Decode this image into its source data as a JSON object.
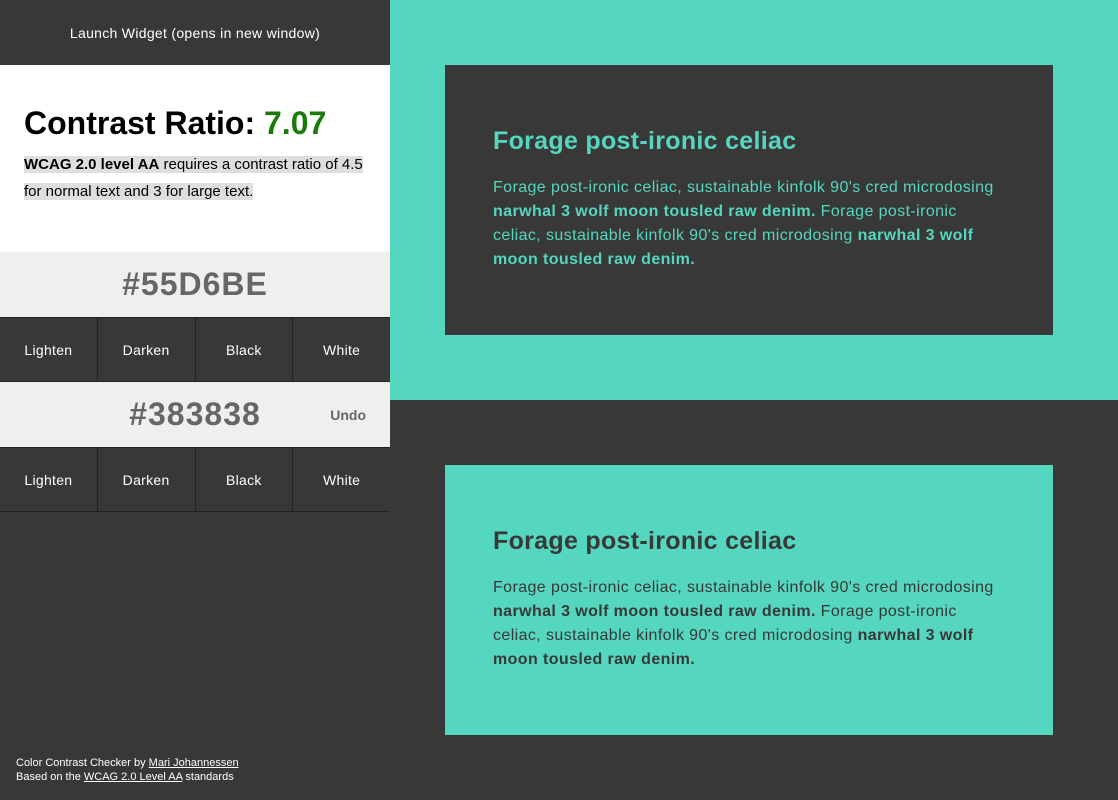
{
  "sidebar": {
    "launch_label": "Launch Widget (opens in new window)",
    "ratio": {
      "label": "Contrast Ratio:",
      "value": "7.07",
      "value_color": "#1a7a0a"
    },
    "wcag": {
      "strong": "WCAG 2.0 level AA",
      "text": " requires a contrast ratio of 4.5 for normal text and 3 for large text."
    },
    "foreground": {
      "hex": "#55D6BE",
      "buttons": [
        "Lighten",
        "Darken",
        "Black",
        "White"
      ]
    },
    "background": {
      "hex": "#383838",
      "undo_label": "Undo",
      "buttons": [
        "Lighten",
        "Darken",
        "Black",
        "White"
      ]
    },
    "credits": {
      "line1_prefix": "Color Contrast Checker by ",
      "author": "Mari Johannessen",
      "line2_prefix": "Based on the ",
      "standard_link": "WCAG 2.0 Level AA",
      "line2_suffix": " standards"
    }
  },
  "preview": {
    "colors": {
      "accent": "#55D6BE",
      "dark": "#383838"
    },
    "heading": "Forage post-ironic celiac",
    "body_part1": "Forage post-ironic celiac, sustainable kinfolk 90's cred microdosing ",
    "body_bold1": "narwhal 3 wolf moon tousled raw denim.",
    "body_part2": " Forage post-ironic celiac, sustainable kinfolk 90's cred microdosing ",
    "body_bold2": "narwhal 3 wolf moon tousled raw denim."
  }
}
